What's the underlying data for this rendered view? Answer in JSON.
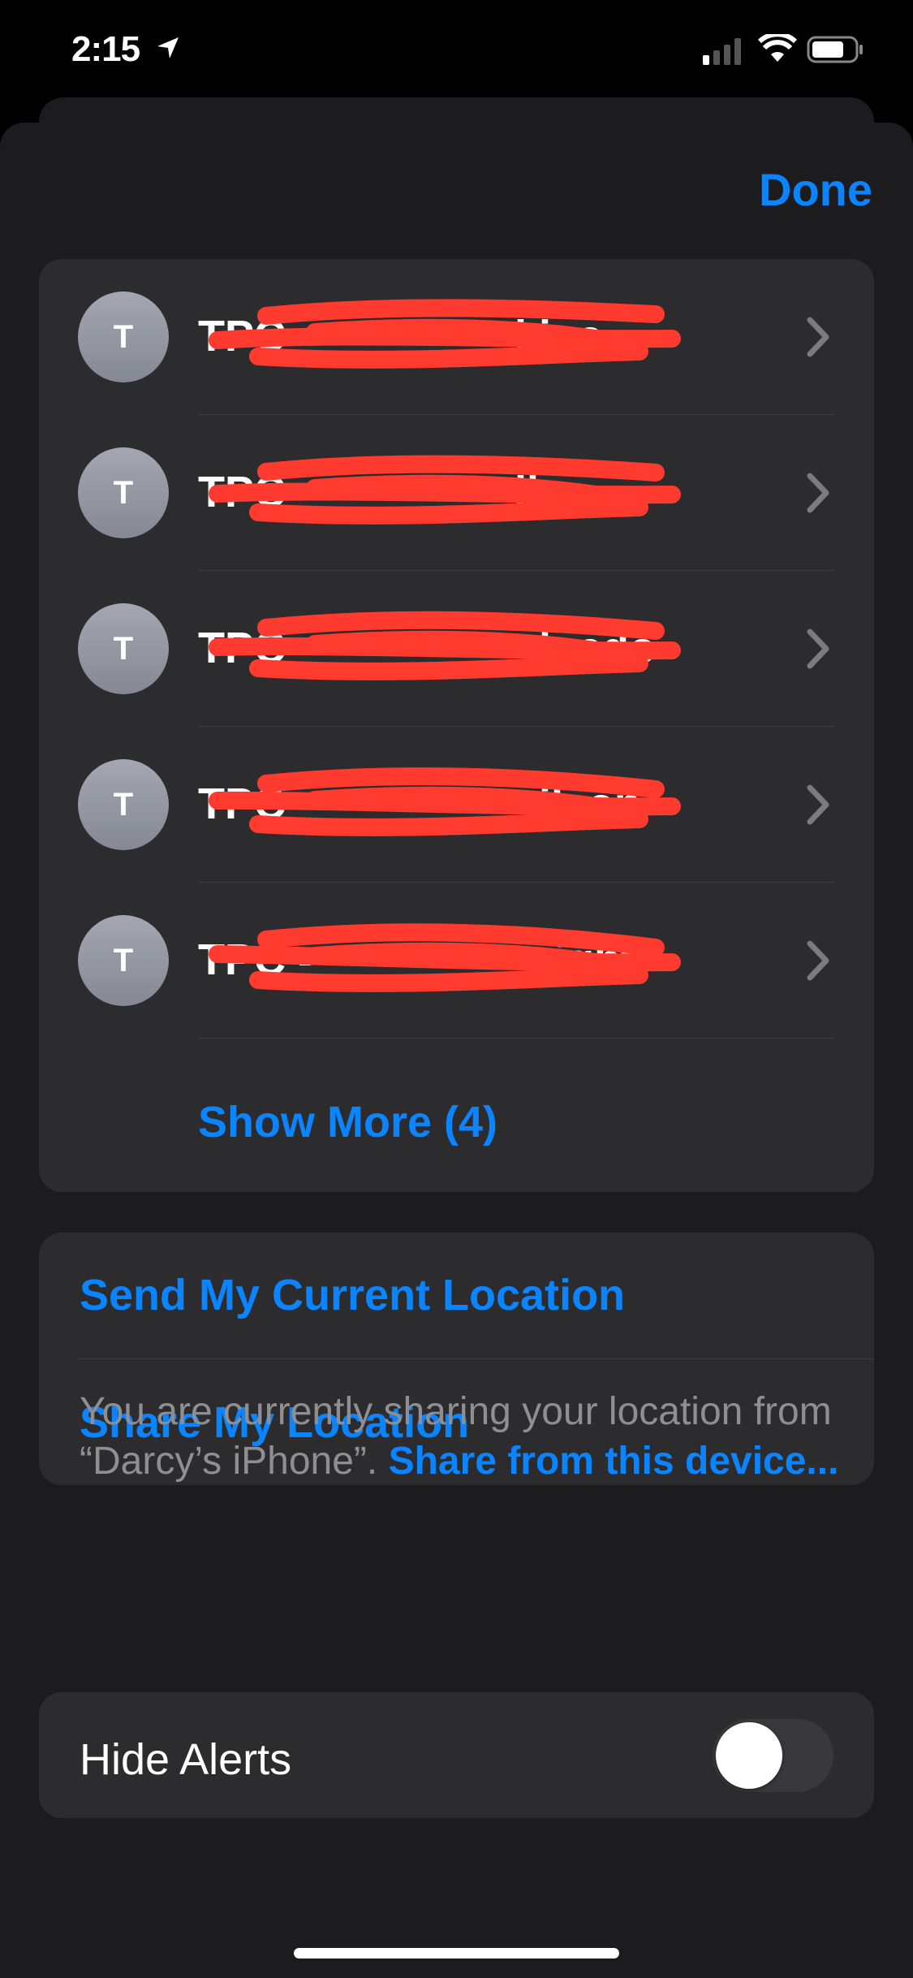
{
  "status_bar": {
    "time": "2:15",
    "icons": [
      "location-arrow-icon",
      "cellular-signal-icon",
      "wifi-icon",
      "battery-icon"
    ]
  },
  "header": {
    "done_label": "Done"
  },
  "contacts": [
    {
      "initial": "T",
      "name_visible_start": "TPC -",
      "name_visible_end": "kins"
    },
    {
      "initial": "T",
      "name_visible_start": "TPC -",
      "name_visible_end": "iles"
    },
    {
      "initial": "T",
      "name_visible_start": "TPC -",
      "name_visible_end": "lgado"
    },
    {
      "initial": "T",
      "name_visible_start": "TPC -",
      "name_visible_end": "ilson"
    },
    {
      "initial": "T",
      "name_visible_start": "TPC -",
      "name_visible_end": "ight"
    }
  ],
  "show_more_label": "Show More (4)",
  "location": {
    "send_label": "Send My Current Location",
    "share_label": "Share My Location"
  },
  "footer": {
    "text": "You are currently sharing your location from “Darcy’s iPhone”. ",
    "link": "Share from this device..."
  },
  "hide_alerts": {
    "label": "Hide Alerts",
    "on": false
  },
  "colors": {
    "accent": "#0a84ff",
    "background": "#1c1c1e",
    "cell": "#2c2c2e",
    "redaction": "#ff3b30"
  }
}
